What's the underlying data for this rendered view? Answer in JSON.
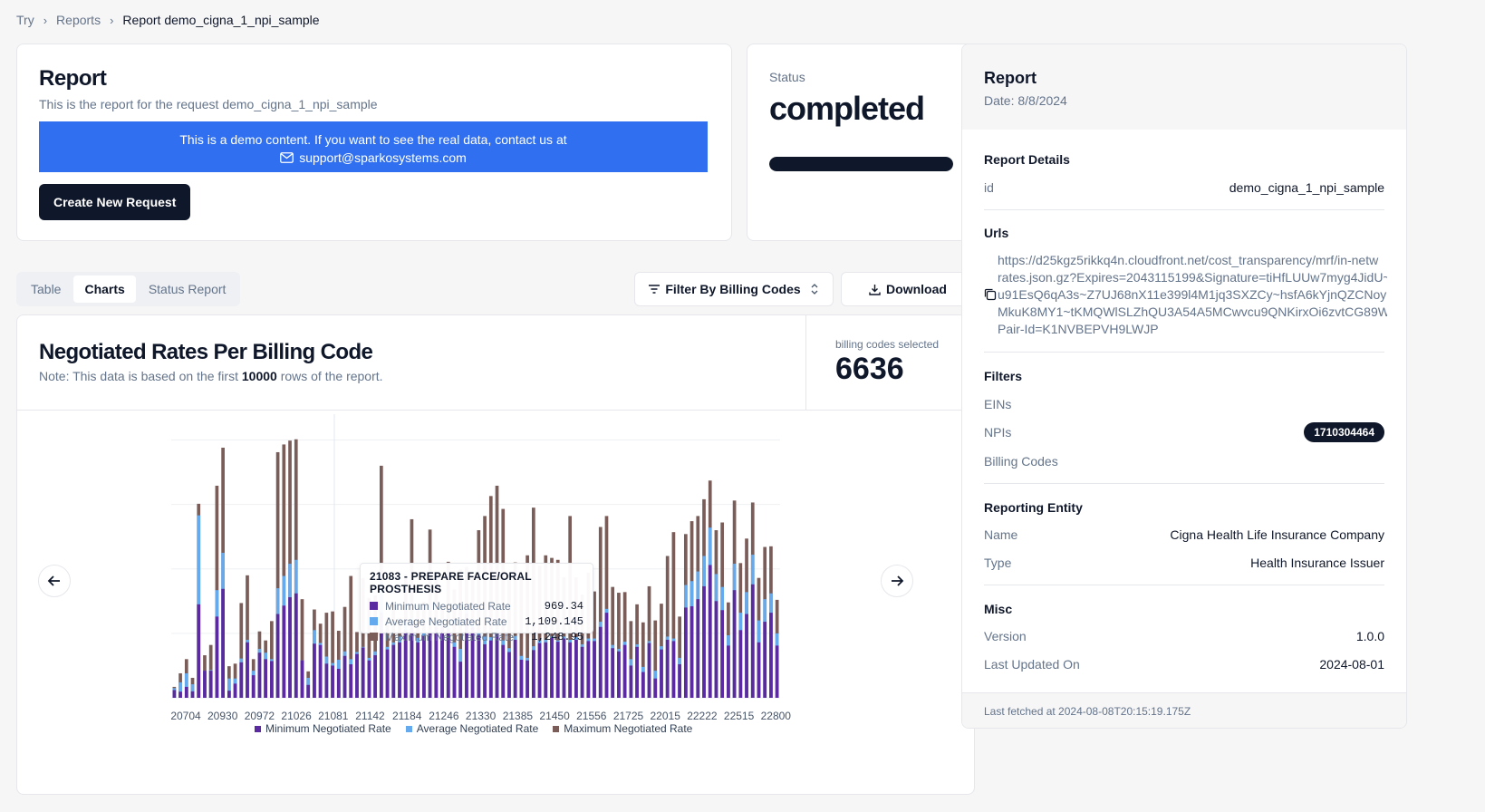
{
  "breadcrumb": {
    "items": [
      "Try",
      "Reports"
    ],
    "current": "Report demo_cigna_1_npi_sample"
  },
  "report_card": {
    "title": "Report",
    "subtitle": "This is the report for the request demo_cigna_1_npi_sample",
    "banner_line1": "This is a demo content. If you want to see the real data, contact us at",
    "banner_email": "support@sparkosystems.com",
    "create_button": "Create New Request"
  },
  "status_card": {
    "label": "Status",
    "value": "completed",
    "progress": 1.0
  },
  "tabs": [
    {
      "label": "Table",
      "active": false
    },
    {
      "label": "Charts",
      "active": true
    },
    {
      "label": "Status Report",
      "active": false
    }
  ],
  "toolbar": {
    "filter_label": "Filter By Billing Codes",
    "download_label": "Download"
  },
  "chart_card": {
    "title": "Negotiated Rates Per Billing Code",
    "note_prefix": "Note: This data is based on the first ",
    "note_rows": "10000",
    "note_suffix": " rows of the report.",
    "selected_label": "billing codes selected",
    "selected_value": "6636"
  },
  "tooltip": {
    "title": "21083 - PREPARE FACE/ORAL PROSTHESIS",
    "rows": [
      {
        "label": "Minimum Negotiated Rate",
        "value": "969.34"
      },
      {
        "label": "Average Negotiated Rate",
        "value": "1,109.145"
      },
      {
        "label": "Maximum Negotiated Rate",
        "value": "1,248.95"
      }
    ]
  },
  "chart_data": {
    "type": "bar",
    "x_ticks": [
      "20704",
      "20930",
      "20972",
      "21026",
      "21081",
      "21142",
      "21184",
      "21246",
      "21330",
      "21385",
      "21450",
      "21556",
      "21725",
      "22015",
      "22222",
      "22515",
      "22800"
    ],
    "series": [
      {
        "name": "Minimum Negotiated Rate",
        "color": "#5b2aa0",
        "values": [
          120,
          95,
          170,
          100,
          1450,
          420,
          420,
          1260,
          1690,
          110,
          220,
          550,
          860,
          350,
          700,
          600,
          570,
          1300,
          1430,
          1560,
          1620,
          580,
          200,
          840,
          820,
          530,
          500,
          450,
          650,
          520,
          680,
          780,
          580,
          660,
          1320,
          750,
          820,
          860,
          1050,
          1150,
          860,
          960,
          1020,
          1100,
          1140,
          1080,
          790,
          560,
          1310,
          1090,
          980,
          830,
          890,
          1020,
          820,
          710,
          900,
          590,
          580,
          740,
          850,
          860,
          930,
          870,
          920,
          860,
          900,
          790,
          880,
          880,
          1100,
          1320,
          770,
          720,
          820,
          500,
          790,
          400,
          850,
          300,
          750,
          900,
          880,
          520,
          1400,
          1420,
          1530,
          1730,
          2060,
          1500,
          1360,
          810,
          1670,
          1050,
          1300,
          1760,
          860,
          1180,
          1320,
          810
        ]
      },
      {
        "name": "Average Negotiated Rate",
        "color": "#66aaee",
        "values": [
          150,
          240,
          380,
          210,
          2830,
          420,
          430,
          1670,
          2250,
          300,
          300,
          610,
          900,
          420,
          760,
          700,
          600,
          1700,
          1890,
          2080,
          2140,
          580,
          310,
          1050,
          850,
          640,
          540,
          590,
          720,
          600,
          710,
          790,
          620,
          720,
          1810,
          790,
          860,
          950,
          1180,
          1240,
          930,
          1040,
          1060,
          1150,
          1220,
          1130,
          860,
          760,
          1360,
          1140,
          1030,
          950,
          940,
          1070,
          890,
          770,
          960,
          650,
          620,
          800,
          890,
          900,
          950,
          890,
          950,
          900,
          940,
          830,
          920,
          920,
          1180,
          1380,
          820,
          760,
          870,
          600,
          830,
          480,
          880,
          420,
          800,
          950,
          920,
          620,
          1750,
          1810,
          1960,
          2200,
          2640,
          1920,
          1720,
          970,
          2080,
          1320,
          1640,
          2220,
          1200,
          1530,
          1620,
          1000
        ]
      },
      {
        "name": "Maximum Negotiated Rate",
        "color": "#7a5c58",
        "values": [
          170,
          380,
          600,
          310,
          3010,
          660,
          820,
          3290,
          3880,
          490,
          530,
          1470,
          1900,
          600,
          1030,
          890,
          1190,
          3810,
          3930,
          3990,
          4010,
          1530,
          410,
          1370,
          1150,
          1320,
          1340,
          1040,
          1410,
          1890,
          1020,
          1860,
          1550,
          1590,
          3600,
          1160,
          1460,
          1240,
          1910,
          2770,
          1360,
          1490,
          2610,
          1870,
          1450,
          2110,
          1680,
          1990,
          2030,
          1870,
          2600,
          2820,
          3130,
          3290,
          2930,
          1930,
          2100,
          1850,
          2210,
          2950,
          2050,
          2210,
          2170,
          2140,
          1870,
          2820,
          1870,
          1600,
          1940,
          1650,
          2650,
          2820,
          1720,
          1630,
          1640,
          1190,
          1450,
          1170,
          1730,
          1200,
          1460,
          2200,
          2570,
          1260,
          2540,
          2740,
          2820,
          3080,
          3370,
          2600,
          2720,
          1480,
          3060,
          2090,
          2470,
          3030,
          1860,
          2340,
          2350,
          1520
        ]
      }
    ],
    "ylim": [
      0,
      4400
    ],
    "grid": true,
    "legend_position": "bottom"
  },
  "side_card": {
    "title": "Report",
    "date": "Date: 8/8/2024",
    "details_title": "Report Details",
    "id_label": "id",
    "id_value": "demo_cigna_1_npi_sample",
    "urls_title": "Urls",
    "url_lines": "https://d25kgz5rikkq4n.cloudfront.net/cost_transparency/mrf/in-netw\nrates.json.gz?Expires=2043115199&Signature=tiHfLUUw7myg4JidU~\nu91EsQ6qA3s~Z7UJ68nX11e399l4M1jq3SXZCy~hsfA6kYjnQZCNoyr!\nMkuK8MY1~tKMQWlSLZhQU3A54A5MCwvcu9QNKirxOi6zvtCG89Wl\nPair-Id=K1NVBEPVH9LWJP",
    "filters_title": "Filters",
    "eins_label": "EINs",
    "npis_label": "NPIs",
    "npi_value": "1710304464",
    "billing_codes_label": "Billing Codes",
    "entity_title": "Reporting Entity",
    "name_label": "Name",
    "name_value": "Cigna Health Life Insurance Company",
    "type_label": "Type",
    "type_value": "Health Insurance Issuer",
    "misc_title": "Misc",
    "version_label": "Version",
    "version_value": "1.0.0",
    "updated_label": "Last Updated On",
    "updated_value": "2024-08-01",
    "footer": "Last fetched at 2024-08-08T20:15:19.175Z"
  }
}
